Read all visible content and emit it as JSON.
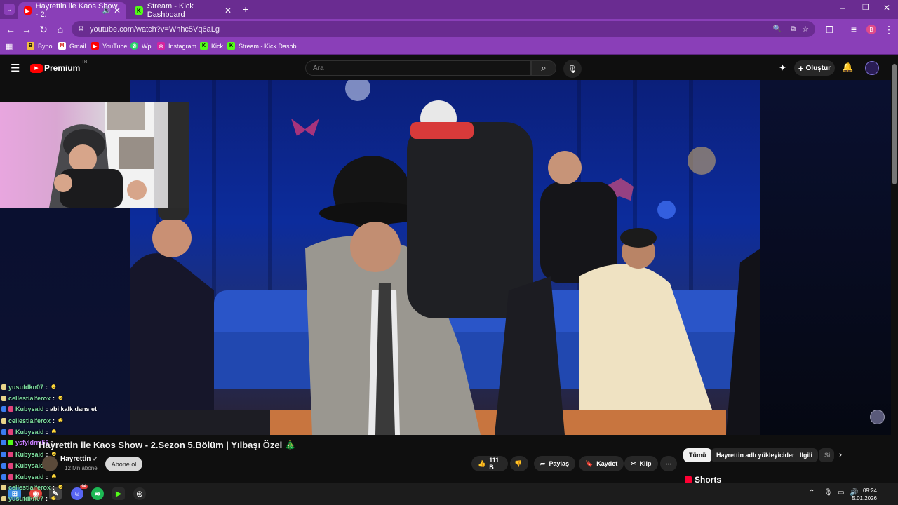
{
  "browser": {
    "tabs": [
      {
        "label": "Hayrettin ile Kaos Show - 2.",
        "active": true
      },
      {
        "label": "Stream - Kick Dashboard",
        "active": false
      }
    ],
    "url": "youtube.com/watch?v=Whhc5Vq6aLg",
    "bookmarks": [
      "Byno",
      "Gmail",
      "YouTube",
      "Wp",
      "Instagram",
      "Kick",
      "Stream - Kick Dashb..."
    ],
    "profile_initial": "B",
    "colors": {
      "tab_strip": "#6a2c91",
      "toolbar": "#8a3fb8"
    }
  },
  "youtube": {
    "logo_text": "Premium",
    "logo_sup": "TR",
    "search_placeholder": "Ara",
    "create_label": "Oluştur"
  },
  "video": {
    "title": "Hayrettin ile Kaos Show - 2.Sezon 5.Bölüm | Yılbaşı Özel 🎄",
    "channel": "Hayrettin",
    "subscribers": "12 Mn abone",
    "subscribe_label": "Abone ol",
    "likes": "111 B",
    "share_label": "Paylaş",
    "save_label": "Kaydet",
    "clip_label": "Klip"
  },
  "chips": [
    "Tümü",
    "Hayrettin adlı yükleyiciden",
    "İlgili",
    "Si"
  ],
  "shorts_label": "Shorts",
  "chat": [
    {
      "user": "yusufdkn07",
      "message": ":",
      "color": "#7fe0a0"
    },
    {
      "user": "cellestialferox",
      "message": ":",
      "color": "#7fe0a0"
    },
    {
      "user": "Kubysaid",
      "message": ": abi kalk dans et",
      "color": "#7fe0a0"
    },
    {
      "user": "cellestialferox",
      "message": ":",
      "color": "#7fe0a0"
    },
    {
      "user": "Kubysaid",
      "message": ":",
      "color": "#7fe0a0"
    },
    {
      "user": "ysfyldrm56",
      "message": ":",
      "color": "#c87fff"
    },
    {
      "user": "Kubysaid",
      "message": ":",
      "color": "#7fe0a0"
    },
    {
      "user": "Kubysaid",
      "message": ":",
      "color": "#7fe0a0"
    },
    {
      "user": "Kubysaid",
      "message": ":",
      "color": "#7fe0a0"
    },
    {
      "user": "cellestialferox",
      "message": ":",
      "color": "#7fe0a0"
    },
    {
      "user": "yusufdkn07",
      "message": ":",
      "color": "#7fe0a0"
    }
  ],
  "taskbar": {
    "time": "09:24",
    "date": "5.01.2026",
    "discord_badge": "94"
  }
}
